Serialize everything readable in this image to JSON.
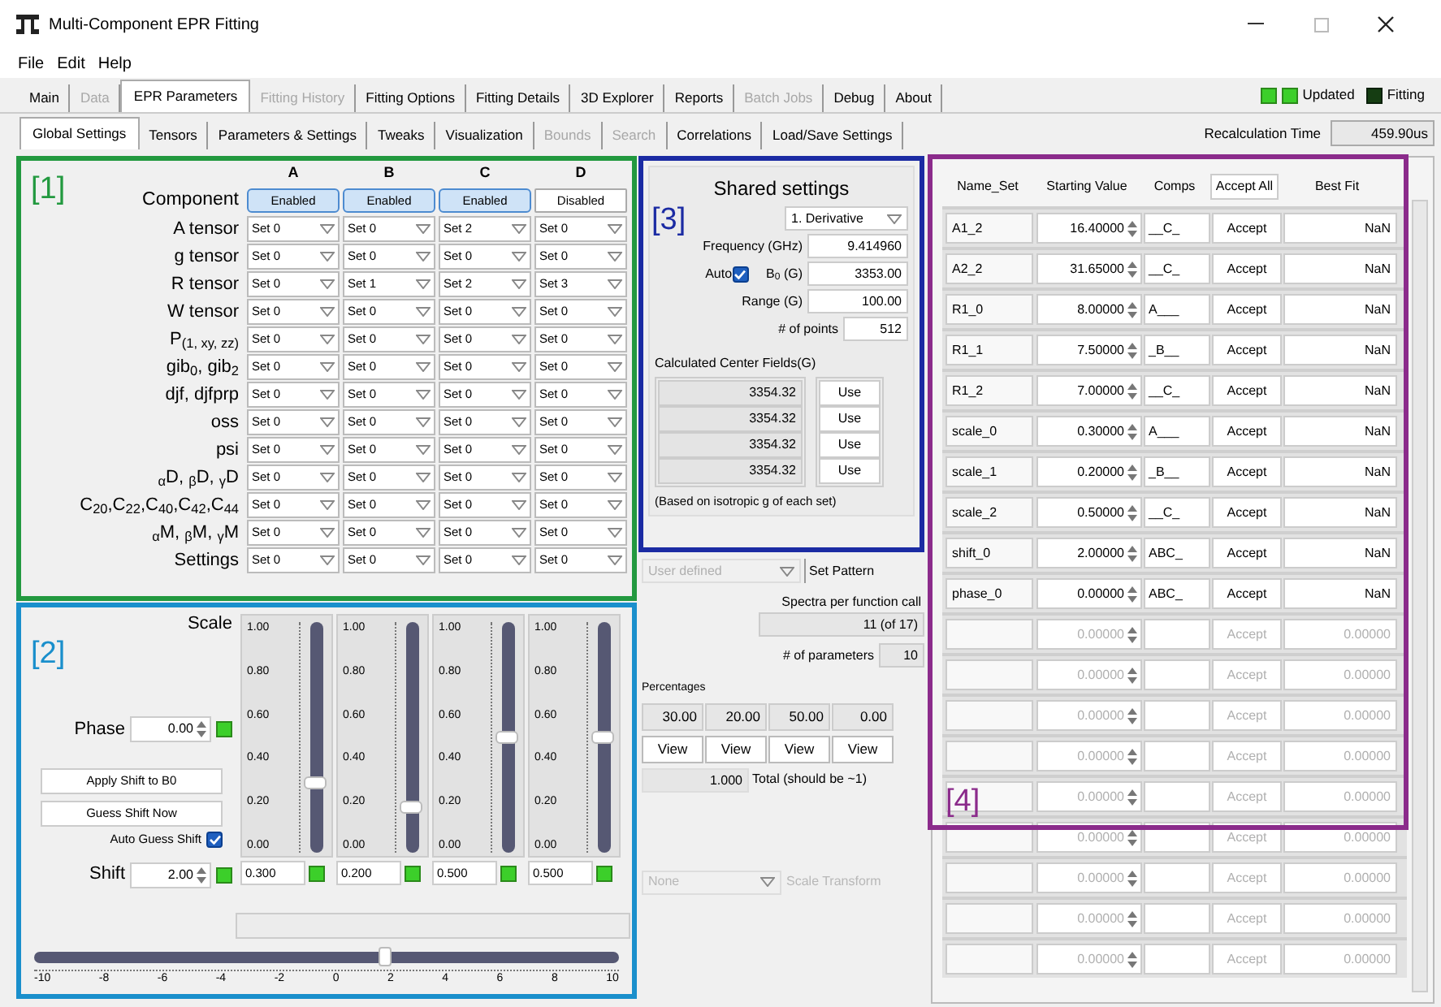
{
  "window": {
    "title": "Multi-Component EPR Fitting"
  },
  "menu": [
    "File",
    "Edit",
    "Help"
  ],
  "main_tabs": [
    {
      "label": "Main",
      "selected": false,
      "disabled": false
    },
    {
      "label": "Data",
      "selected": false,
      "disabled": true
    },
    {
      "label": "EPR Parameters",
      "selected": true,
      "disabled": false
    },
    {
      "label": "Fitting History",
      "selected": false,
      "disabled": true
    },
    {
      "label": "Fitting Options",
      "selected": false,
      "disabled": false
    },
    {
      "label": "Fitting Details",
      "selected": false,
      "disabled": false
    },
    {
      "label": "3D Explorer",
      "selected": false,
      "disabled": false
    },
    {
      "label": "Reports",
      "selected": false,
      "disabled": false
    },
    {
      "label": "Batch Jobs",
      "selected": false,
      "disabled": true
    },
    {
      "label": "Debug",
      "selected": false,
      "disabled": false
    },
    {
      "label": "About",
      "selected": false,
      "disabled": false
    }
  ],
  "indicators": [
    {
      "on": true
    },
    {
      "on": true,
      "label": "Updated"
    },
    {
      "on": false,
      "label": "Fitting"
    }
  ],
  "sub_tabs": [
    {
      "label": "Global Settings",
      "selected": true,
      "disabled": false
    },
    {
      "label": "Tensors",
      "selected": false,
      "disabled": false
    },
    {
      "label": "Parameters & Settings",
      "selected": false,
      "disabled": false
    },
    {
      "label": "Tweaks",
      "selected": false,
      "disabled": false
    },
    {
      "label": "Visualization",
      "selected": false,
      "disabled": false
    },
    {
      "label": "Bounds",
      "selected": false,
      "disabled": true
    },
    {
      "label": "Search",
      "selected": false,
      "disabled": true
    },
    {
      "label": "Correlations",
      "selected": false,
      "disabled": false
    },
    {
      "label": "Load/Save Settings",
      "selected": false,
      "disabled": false
    }
  ],
  "recalculation_time": {
    "label": "Recalculation Time",
    "value": "459.90us"
  },
  "components_panel": {
    "section_label": "[1]",
    "row_header": "Component",
    "columns": [
      {
        "name": "A",
        "button": "Enabled",
        "enabled": true
      },
      {
        "name": "B",
        "button": "Enabled",
        "enabled": true
      },
      {
        "name": "C",
        "button": "Enabled",
        "enabled": true
      },
      {
        "name": "D",
        "button": "Disabled",
        "enabled": false
      }
    ],
    "rows": [
      {
        "label": "A tensor",
        "values": [
          "Set 0",
          "Set 0",
          "Set 2",
          "Set 0"
        ]
      },
      {
        "label": "g tensor",
        "values": [
          "Set 0",
          "Set 0",
          "Set 0",
          "Set 0"
        ]
      },
      {
        "label": "R tensor",
        "values": [
          "Set 0",
          "Set 1",
          "Set 2",
          "Set 3"
        ]
      },
      {
        "label": "W tensor",
        "values": [
          "Set 0",
          "Set 0",
          "Set 0",
          "Set 0"
        ]
      },
      {
        "label": "P$_{(1, xy, zz)}$",
        "values": [
          "Set 0",
          "Set 0",
          "Set 0",
          "Set 0"
        ]
      },
      {
        "label": "gib$_{0}$, gib$_{2}$",
        "values": [
          "Set 0",
          "Set 0",
          "Set 0",
          "Set 0"
        ]
      },
      {
        "label": "djf, djfprp",
        "values": [
          "Set 0",
          "Set 0",
          "Set 0",
          "Set 0"
        ]
      },
      {
        "label": "oss",
        "values": [
          "Set 0",
          "Set 0",
          "Set 0",
          "Set 0"
        ]
      },
      {
        "label": "psi",
        "values": [
          "Set 0",
          "Set 0",
          "Set 0",
          "Set 0"
        ]
      },
      {
        "label": "$_{α}$D, $_{β}$D, $_{γ}$D",
        "values": [
          "Set 0",
          "Set 0",
          "Set 0",
          "Set 0"
        ]
      },
      {
        "label": "C$_{20}$,C$_{22}$,C$_{40}$,C$_{42}$,C$_{44}$",
        "values": [
          "Set 0",
          "Set 0",
          "Set 0",
          "Set 0"
        ]
      },
      {
        "label": "$_{α}$M, $_{β}$M, $_{γ}$M",
        "values": [
          "Set 0",
          "Set 0",
          "Set 0",
          "Set 0"
        ]
      },
      {
        "label": "Settings",
        "values": [
          "Set 0",
          "Set 0",
          "Set 0",
          "Set 0"
        ]
      }
    ]
  },
  "scale_panel": {
    "section_label": "[2]",
    "title": "Scale",
    "phase": {
      "label": "Phase",
      "value": "0.00"
    },
    "apply_button": "Apply Shift to B0",
    "guess_button": "Guess Shift Now",
    "auto_guess": {
      "label": "Auto Guess Shift",
      "checked": true
    },
    "shift": {
      "label": "Shift",
      "value": "2.00"
    },
    "sliders": [
      {
        "ticks": [
          "1.00",
          "0.80",
          "0.60",
          "0.40",
          "0.20",
          "0.00"
        ],
        "level": 0.3,
        "value": "0.300"
      },
      {
        "ticks": [
          "1.00",
          "0.80",
          "0.60",
          "0.40",
          "0.20",
          "0.00"
        ],
        "level": 0.2,
        "value": "0.200"
      },
      {
        "ticks": [
          "1.00",
          "0.80",
          "0.60",
          "0.40",
          "0.20",
          "0.00"
        ],
        "level": 0.5,
        "value": "0.500"
      },
      {
        "ticks": [
          "1.00",
          "0.80",
          "0.60",
          "0.40",
          "0.20",
          "0.00"
        ],
        "level": 0.5,
        "value": "0.500"
      }
    ],
    "shift_slider": {
      "level": 0.6,
      "ticks": [
        "-10",
        "-8",
        "-6",
        "-4",
        "-2",
        "0",
        "2",
        "4",
        "6",
        "8",
        "10"
      ]
    }
  },
  "shared_settings": {
    "section_label": "[3]",
    "title": "Shared settings",
    "mode": "1. Derivative",
    "frequency": {
      "label": "Frequency (GHz)",
      "value": "9.414960"
    },
    "auto": {
      "label": "Auto",
      "checked": true
    },
    "b0": {
      "label": "B$_{0}$ (G)",
      "value": "3353.00"
    },
    "range": {
      "label": "Range (G)",
      "value": "100.00"
    },
    "points": {
      "label": "# of points",
      "value": "512"
    },
    "center_fields_title": "Calculated Center Fields(G)",
    "center_fields": [
      {
        "value": "3354.32",
        "button": "Use"
      },
      {
        "value": "3354.32",
        "button": "Use"
      },
      {
        "value": "3354.32",
        "button": "Use"
      },
      {
        "value": "3354.32",
        "button": "Use"
      }
    ],
    "note": "(Based on isotropic g of each set)"
  },
  "pattern": {
    "value": "User defined",
    "disabled": true,
    "button": "Set Pattern"
  },
  "spectra_per_call": {
    "label": "Spectra per function call",
    "value": "11 (of 17)"
  },
  "parameters_count": {
    "label": "# of parameters",
    "value": "10"
  },
  "percentages": {
    "title": "Percentages",
    "values": [
      "30.00",
      "20.00",
      "50.00",
      "0.00"
    ],
    "view_buttons": [
      "View",
      "View",
      "View",
      "View"
    ],
    "total": "1.000",
    "total_label": "Total (should be ~1)"
  },
  "scale_transform": {
    "value": "None",
    "label": "Scale Transform",
    "disabled": true
  },
  "fit_table": {
    "section_label": "[4]",
    "columns": [
      "Name_Set",
      "Starting Value",
      "Comps"
    ],
    "accept_all": "Accept All",
    "best_fit_header": "Best Fit",
    "rows": [
      {
        "name": "A1_2",
        "start": "16.40000",
        "comps": "__C_",
        "accept": "Accept",
        "best": "NaN",
        "disabled": false
      },
      {
        "name": "A2_2",
        "start": "31.65000",
        "comps": "__C_",
        "accept": "Accept",
        "best": "NaN",
        "disabled": false
      },
      {
        "name": "R1_0",
        "start": "8.00000",
        "comps": "A___",
        "accept": "Accept",
        "best": "NaN",
        "disabled": false
      },
      {
        "name": "R1_1",
        "start": "7.50000",
        "comps": "_B__",
        "accept": "Accept",
        "best": "NaN",
        "disabled": false
      },
      {
        "name": "R1_2",
        "start": "7.00000",
        "comps": "__C_",
        "accept": "Accept",
        "best": "NaN",
        "disabled": false
      },
      {
        "name": "scale_0",
        "start": "0.30000",
        "comps": "A___",
        "accept": "Accept",
        "best": "NaN",
        "disabled": false
      },
      {
        "name": "scale_1",
        "start": "0.20000",
        "comps": "_B__",
        "accept": "Accept",
        "best": "NaN",
        "disabled": false
      },
      {
        "name": "scale_2",
        "start": "0.50000",
        "comps": "__C_",
        "accept": "Accept",
        "best": "NaN",
        "disabled": false
      },
      {
        "name": "shift_0",
        "start": "2.00000",
        "comps": "ABC_",
        "accept": "Accept",
        "best": "NaN",
        "disabled": false
      },
      {
        "name": "phase_0",
        "start": "0.00000",
        "comps": "ABC_",
        "accept": "Accept",
        "best": "NaN",
        "disabled": false
      },
      {
        "start": "0.00000",
        "accept": "Accept",
        "best": "0.00000",
        "disabled": true
      },
      {
        "start": "0.00000",
        "accept": "Accept",
        "best": "0.00000",
        "disabled": true
      },
      {
        "start": "0.00000",
        "accept": "Accept",
        "best": "0.00000",
        "disabled": true
      },
      {
        "start": "0.00000",
        "accept": "Accept",
        "best": "0.00000",
        "disabled": true
      },
      {
        "start": "0.00000",
        "accept": "Accept",
        "best": "0.00000",
        "disabled": true
      },
      {
        "start": "0.00000",
        "accept": "Accept",
        "best": "0.00000",
        "disabled": true
      },
      {
        "start": "0.00000",
        "accept": "Accept",
        "best": "0.00000",
        "disabled": true
      },
      {
        "start": "0.00000",
        "accept": "Accept",
        "best": "0.00000",
        "disabled": true
      },
      {
        "start": "0.00000",
        "accept": "Accept",
        "best": "0.00000",
        "disabled": true
      }
    ]
  }
}
